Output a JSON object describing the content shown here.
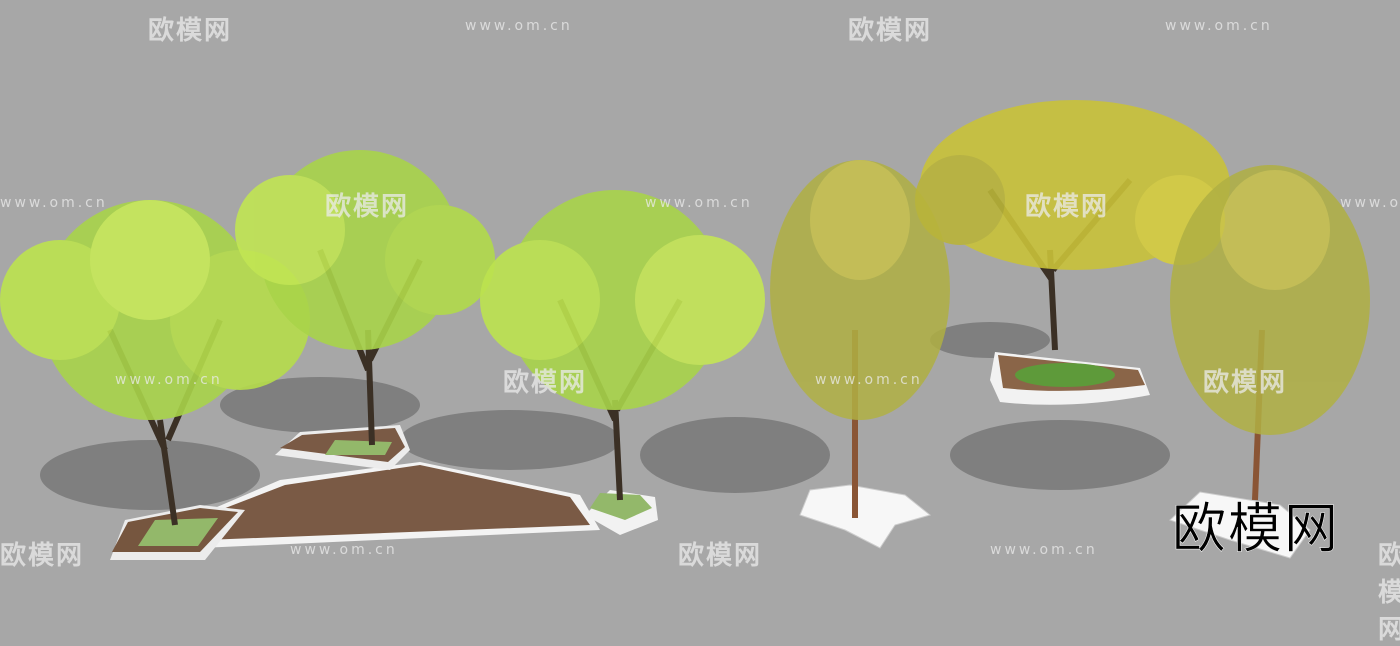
{
  "watermark": {
    "brand": "欧模网",
    "url": "www.om.cn"
  },
  "logo_text": "欧模网",
  "colors": {
    "background": "#a7a7a7",
    "foliage_light": "#b6e04a",
    "foliage_yellow": "#c9c23a",
    "deck": "#7a5a45",
    "planter": "#f2f2f2"
  }
}
